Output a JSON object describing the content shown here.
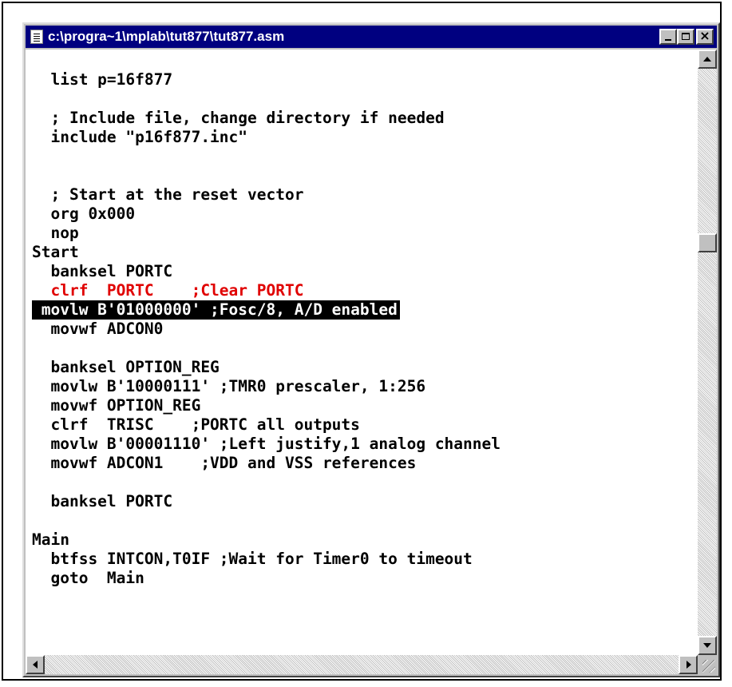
{
  "window": {
    "title": "c:\\progra~1\\mplab\\tut877\\tut877.asm",
    "icon": "document-icon",
    "controls": [
      "minimize-icon",
      "maximize-icon",
      "close-icon"
    ],
    "close_glyph": "×"
  },
  "editor": {
    "highlight_color": "#e00000",
    "selection_color": "#000000",
    "lines": [
      "  list p=16f877",
      "",
      "  ; Include file, change directory if needed",
      "  include \"p16f877.inc\"",
      "",
      "",
      "  ; Start at the reset vector",
      "  org 0x000",
      "  nop",
      "Start",
      "  banksel PORTC",
      "  clrf  PORTC    ;Clear PORTC",
      " movlw B'01000000' ;Fosc/8, A/D enabled",
      "  movwf ADCON0",
      "",
      "  banksel OPTION_REG",
      "  movlw B'10000111' ;TMR0 prescaler, 1:256",
      "  movwf OPTION_REG",
      "  clrf  TRISC    ;PORTC all outputs",
      "  movlw B'00001110' ;Left justify,1 analog channel",
      "  movwf ADCON1    ;VDD and VSS references",
      "",
      "  banksel PORTC",
      "",
      "Main",
      "  btfss INTCON,T0IF ;Wait for Timer0 to timeout",
      "  goto  Main"
    ],
    "highlighted_line_index": 11,
    "selected_line_index": 12
  },
  "scrollbars": {
    "vertical_position": 0.3,
    "horizontal_position": 0.0
  }
}
